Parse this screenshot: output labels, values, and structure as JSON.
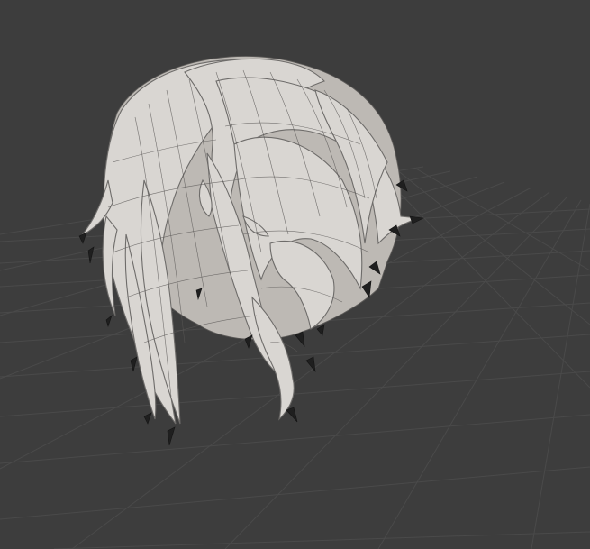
{
  "scene": {
    "mode": "3d-viewport",
    "object": "hair-mesh",
    "shading": "solid-with-wireframe"
  },
  "colors": {
    "background": "#3d3d3d",
    "grid": "#4a4a4a",
    "mesh_light": "#d9d6d2",
    "mesh_shadow": "#bdb9b4",
    "wire": "#5a5856",
    "strand_tip": "#1f1f1f"
  },
  "icons": {
    "viewport": "3d-viewport",
    "grid": "floor-grid",
    "mesh": "hair-mesh-object"
  }
}
